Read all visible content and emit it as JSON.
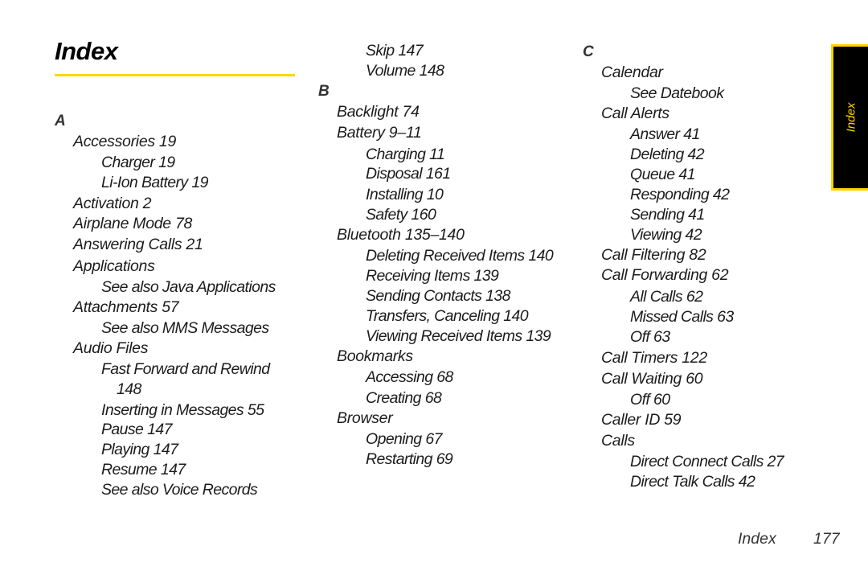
{
  "page": {
    "title": "Index",
    "accent_color": "#ffd700",
    "side_tab": {
      "label": "Index",
      "background": "#000000",
      "color": "#ffd400"
    },
    "footer": {
      "section": "Index",
      "page_number": "177"
    }
  },
  "columns": [
    {
      "entries": [
        {
          "type": "letter",
          "text": "A"
        },
        {
          "type": "main",
          "text": "Accessories 19"
        },
        {
          "type": "sub",
          "text": "Charger 19"
        },
        {
          "type": "sub",
          "text": "Li-Ion Battery 19"
        },
        {
          "type": "main",
          "text": "Activation 2"
        },
        {
          "type": "main",
          "text": "Airplane Mode 78"
        },
        {
          "type": "main",
          "text": "Answering Calls 21"
        },
        {
          "type": "main",
          "text": "Applications"
        },
        {
          "type": "sub",
          "text": "See also Java Applications"
        },
        {
          "type": "main",
          "text": "Attachments 57"
        },
        {
          "type": "sub",
          "text": "See also MMS Messages"
        },
        {
          "type": "main",
          "text": "Audio Files"
        },
        {
          "type": "sub",
          "text": "Fast Forward and Rewind"
        },
        {
          "type": "subcont",
          "text": "148"
        },
        {
          "type": "sub",
          "text": "Inserting in Messages 55"
        },
        {
          "type": "sub",
          "text": "Pause 147"
        },
        {
          "type": "sub",
          "text": "Playing 147"
        },
        {
          "type": "sub",
          "text": "Resume 147"
        },
        {
          "type": "sub",
          "text": "See also Voice Records"
        }
      ]
    },
    {
      "entries": [
        {
          "type": "sub",
          "text": "Skip 147"
        },
        {
          "type": "sub",
          "text": "Volume 148"
        },
        {
          "type": "letter",
          "text": "B"
        },
        {
          "type": "main",
          "text": "Backlight 74"
        },
        {
          "type": "main",
          "text": "Battery 9–11"
        },
        {
          "type": "sub",
          "text": "Charging 11"
        },
        {
          "type": "sub",
          "text": "Disposal 161"
        },
        {
          "type": "sub",
          "text": "Installing 10"
        },
        {
          "type": "sub",
          "text": "Safety 160"
        },
        {
          "type": "main",
          "text": "Bluetooth 135–140"
        },
        {
          "type": "sub",
          "text": "Deleting Received Items 140"
        },
        {
          "type": "sub",
          "text": "Receiving Items 139"
        },
        {
          "type": "sub",
          "text": "Sending Contacts 138"
        },
        {
          "type": "sub",
          "text": "Transfers, Canceling 140"
        },
        {
          "type": "sub",
          "text": "Viewing Received Items 139"
        },
        {
          "type": "main",
          "text": "Bookmarks"
        },
        {
          "type": "sub",
          "text": "Accessing 68"
        },
        {
          "type": "sub",
          "text": "Creating 68"
        },
        {
          "type": "main",
          "text": "Browser"
        },
        {
          "type": "sub",
          "text": "Opening 67"
        },
        {
          "type": "sub",
          "text": "Restarting 69"
        }
      ]
    },
    {
      "entries": [
        {
          "type": "letter",
          "text": "C"
        },
        {
          "type": "main",
          "text": "Calendar"
        },
        {
          "type": "sub",
          "text": "See Datebook"
        },
        {
          "type": "main",
          "text": "Call Alerts"
        },
        {
          "type": "sub",
          "text": "Answer 41"
        },
        {
          "type": "sub",
          "text": "Deleting 42"
        },
        {
          "type": "sub",
          "text": "Queue 41"
        },
        {
          "type": "sub",
          "text": "Responding 42"
        },
        {
          "type": "sub",
          "text": "Sending 41"
        },
        {
          "type": "sub",
          "text": "Viewing 42"
        },
        {
          "type": "main",
          "text": "Call Filtering 82"
        },
        {
          "type": "main",
          "text": "Call Forwarding 62"
        },
        {
          "type": "sub",
          "text": "All Calls 62"
        },
        {
          "type": "sub",
          "text": "Missed Calls 63"
        },
        {
          "type": "sub",
          "text": "Off 63"
        },
        {
          "type": "main",
          "text": "Call Timers 122"
        },
        {
          "type": "main",
          "text": "Call Waiting 60"
        },
        {
          "type": "sub",
          "text": "Off 60"
        },
        {
          "type": "main",
          "text": "Caller ID 59"
        },
        {
          "type": "main",
          "text": "Calls"
        },
        {
          "type": "sub",
          "text": "Direct Connect Calls 27"
        },
        {
          "type": "sub",
          "text": "Direct Talk Calls 42"
        }
      ]
    }
  ]
}
